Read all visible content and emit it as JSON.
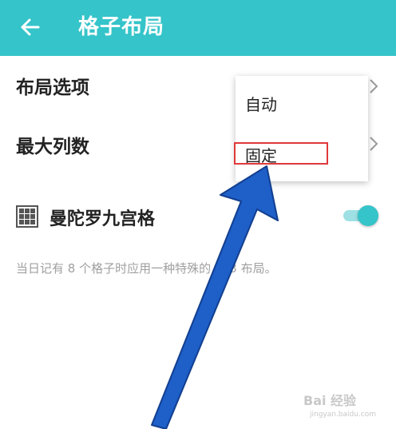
{
  "appbar": {
    "back_icon": "arrow-left-icon",
    "title": "格子布局",
    "color": "#35c4c9"
  },
  "settings": {
    "layout_option_label": "布局选项",
    "max_columns_label": "最大列数",
    "mandala_label": "曼陀罗九宫格",
    "mandala_icon": "grid-3x3-icon",
    "mandala_enabled": true,
    "mandala_description": "当日记有 8 个格子时应用一种特殊的 3x3 布局。"
  },
  "popup": {
    "items": [
      "自动",
      "固定"
    ],
    "highlighted": "固定",
    "highlight_color": "#e0393a"
  },
  "annotation": {
    "arrow_color": "#1e5fc8"
  },
  "watermark": {
    "text": "Bai 经验",
    "sub": "jingyan.baidu.com"
  }
}
